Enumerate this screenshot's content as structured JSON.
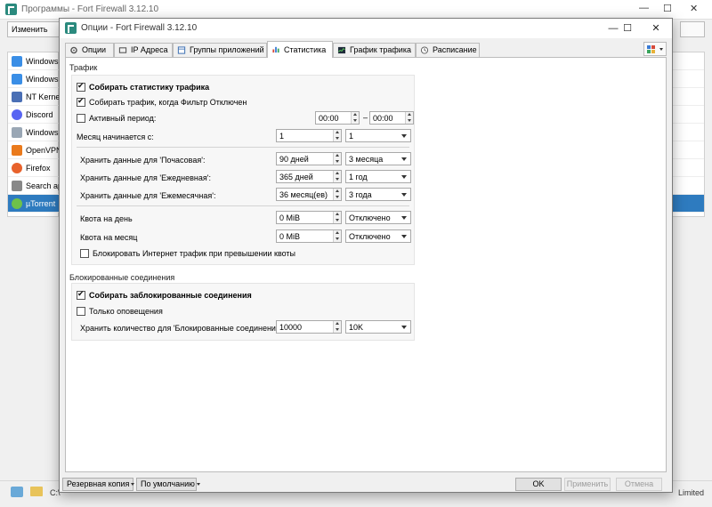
{
  "bg": {
    "title": "Программы - Fort Firewall 3.12.10",
    "toolbar_label": "Изменить",
    "min": "—",
    "max": "☐",
    "close": "✕",
    "apps": [
      {
        "label": "Windows I",
        "color": "#3a8ee6"
      },
      {
        "label": "Windows I",
        "color": "#3a8ee6"
      },
      {
        "label": "NT Kernel",
        "color": "#4a6fb5"
      },
      {
        "label": "Discord",
        "color": "#5865f2"
      },
      {
        "label": "Windows I",
        "color": "#9aa7b5"
      },
      {
        "label": "OpenVPN",
        "color": "#ea7a1c"
      },
      {
        "label": "Firefox",
        "color": "#e8622c"
      },
      {
        "label": "Search ap",
        "color": "#888888"
      },
      {
        "label": "µTorrent",
        "color": "#6ec14a"
      }
    ],
    "status_path": "C:\\",
    "status_company": "Limited"
  },
  "dialog": {
    "title": "Опции - Fort Firewall 3.12.10",
    "min": "—",
    "max": "☐",
    "close": "✕",
    "tabs": [
      {
        "label": "Опции",
        "icon": "gear-icon"
      },
      {
        "label": "IP Адреса",
        "icon": "ip-icon"
      },
      {
        "label": "Группы приложений",
        "icon": "groups-icon"
      },
      {
        "label": "Статистика",
        "icon": "bar-chart-icon"
      },
      {
        "label": "График трафика",
        "icon": "line-chart-icon"
      },
      {
        "label": "Расписание",
        "icon": "clock-icon"
      }
    ],
    "active_tab": 3
  },
  "traffic": {
    "group_title": "Трафик",
    "collect_stats": "Собирать статистику трафика",
    "collect_when_filter_off": "Собирать трафик, когда Фильтр Отключен",
    "active_period": "Активный период:",
    "period_from": "00:00",
    "period_to": "00:00",
    "month_start_label": "Месяц начинается с:",
    "month_start_value": "1",
    "month_start_combo": "1",
    "hourly_label": "Хранить данные для 'Почасовая':",
    "hourly_value": "90 дней",
    "hourly_combo": "3 месяца",
    "daily_label": "Хранить данные для 'Ежедневная':",
    "daily_value": "365 дней",
    "daily_combo": "1 год",
    "monthly_label": "Хранить данные для 'Ежемесячная':",
    "monthly_value": "36 месяц(ев)",
    "monthly_combo": "3 года",
    "quota_day_label": "Квота на день",
    "quota_day_value": "0 MiB",
    "quota_day_combo": "Отключено",
    "quota_month_label": "Квота на месяц",
    "quota_month_value": "0 MiB",
    "quota_month_combo": "Отключено",
    "block_over_quota": "Блокировать Интернет трафик при превышении квоты"
  },
  "blocked": {
    "group_title": "Блокированные соединения",
    "collect_blocked": "Собирать заблокированные соединения",
    "only_notifications": "Только оповещения",
    "keep_count_label": "Хранить количество для 'Блокированные соединения':",
    "keep_count_value": "10000",
    "keep_count_combo": "10K"
  },
  "footer": {
    "backup": "Резервная копия",
    "defaults": "По умолчанию",
    "ok": "OK",
    "apply": "Применить",
    "cancel": "Отмена"
  }
}
